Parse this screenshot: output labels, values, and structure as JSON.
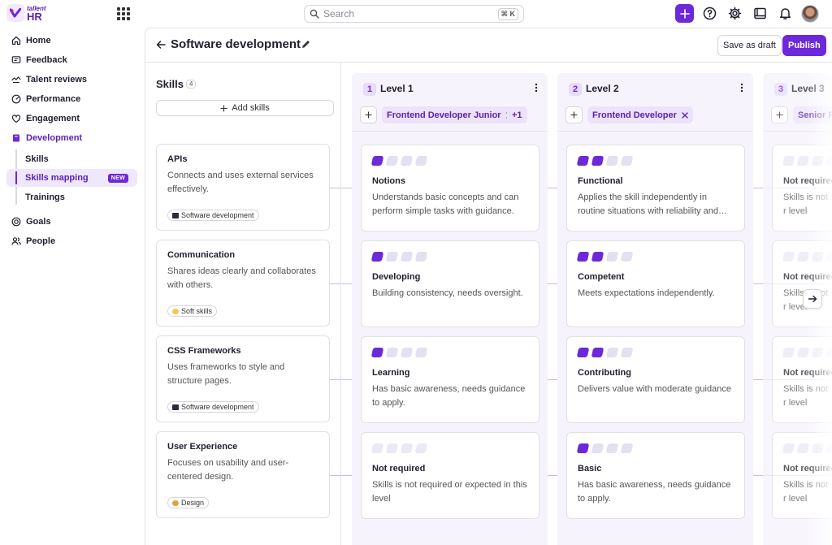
{
  "brand": {
    "name_small": "tallent",
    "name_big": "HR"
  },
  "search": {
    "placeholder": "Search",
    "shortcut": "⌘ K"
  },
  "sidebar": {
    "items": [
      {
        "label": "Home",
        "icon": "home-icon"
      },
      {
        "label": "Feedback",
        "icon": "feedback-icon"
      },
      {
        "label": "Talent reviews",
        "icon": "talent-reviews-icon"
      },
      {
        "label": "Performance",
        "icon": "performance-icon"
      },
      {
        "label": "Engagement",
        "icon": "engagement-icon"
      },
      {
        "label": "Development",
        "icon": "development-icon"
      },
      {
        "label": "Goals",
        "icon": "goals-icon"
      },
      {
        "label": "People",
        "icon": "people-icon"
      }
    ],
    "sub_items": [
      {
        "label": "Skills"
      },
      {
        "label": "Skills mapping",
        "badge": "NEW"
      },
      {
        "label": "Trainings"
      }
    ]
  },
  "header": {
    "title": "Software development",
    "save_draft": "Save as draft",
    "publish": "Publish"
  },
  "skills": {
    "title": "Skills",
    "count": "4",
    "add_label": "Add skills",
    "list": [
      {
        "name": "APIs",
        "desc": "Connects and uses external services effectively.",
        "tag": "Software development",
        "tag_color": "#2b2b3a"
      },
      {
        "name": "Communication",
        "desc": "Shares ideas clearly and collaborates with others.",
        "tag": "Soft skills",
        "tag_color": "#f5c451"
      },
      {
        "name": "CSS Frameworks",
        "desc": "Uses frameworks to style and structure pages.",
        "tag": "Software development",
        "tag_color": "#2b2b3a"
      },
      {
        "name": "User Experience",
        "desc": "Focuses on usability and user-centered design.",
        "tag": "Design",
        "tag_color": "#d9a441"
      }
    ]
  },
  "levels": [
    {
      "num": "1",
      "name": "Level 1",
      "role": "Frontend Developer Junior",
      "more": "+1",
      "cards": [
        {
          "filled": 1,
          "title": "Notions",
          "desc": "Understands basic concepts and can perform simple tasks with guidance."
        },
        {
          "filled": 1,
          "title": "Developing",
          "desc": "Building consistency, needs oversight."
        },
        {
          "filled": 1,
          "title": "Learning",
          "desc": "Has basic awareness, needs guidance to apply."
        },
        {
          "filled": 0,
          "title": "Not required",
          "desc": "Skills is not required or expected in this level"
        }
      ]
    },
    {
      "num": "2",
      "name": "Level 2",
      "role": "Frontend Developer",
      "cards": [
        {
          "filled": 2,
          "title": "Functional",
          "desc": "Applies the skill independently in routine situations with reliability and consisten…"
        },
        {
          "filled": 2,
          "title": "Competent",
          "desc": "Meets expectations independently."
        },
        {
          "filled": 2,
          "title": "Contributing",
          "desc": "Delivers value with moderate guidance"
        },
        {
          "filled": 1,
          "title": "Basic",
          "desc": "Has basic awareness, needs guidance to apply."
        }
      ]
    },
    {
      "num": "3",
      "name": "Level 3",
      "role": "Senior Fr",
      "cards": [
        {
          "filled": 0,
          "title": "Not required",
          "desc": "Skills is not r level"
        },
        {
          "filled": 0,
          "title": "Not required",
          "desc": "Skills is not r level"
        },
        {
          "filled": 0,
          "title": "Not required",
          "desc": "Skills is not r level"
        },
        {
          "filled": 0,
          "title": "Not required",
          "desc": "Skills is not r level"
        }
      ]
    }
  ],
  "colors": {
    "accent": "#6d28d9",
    "accent_soft": "#ece3fb"
  }
}
